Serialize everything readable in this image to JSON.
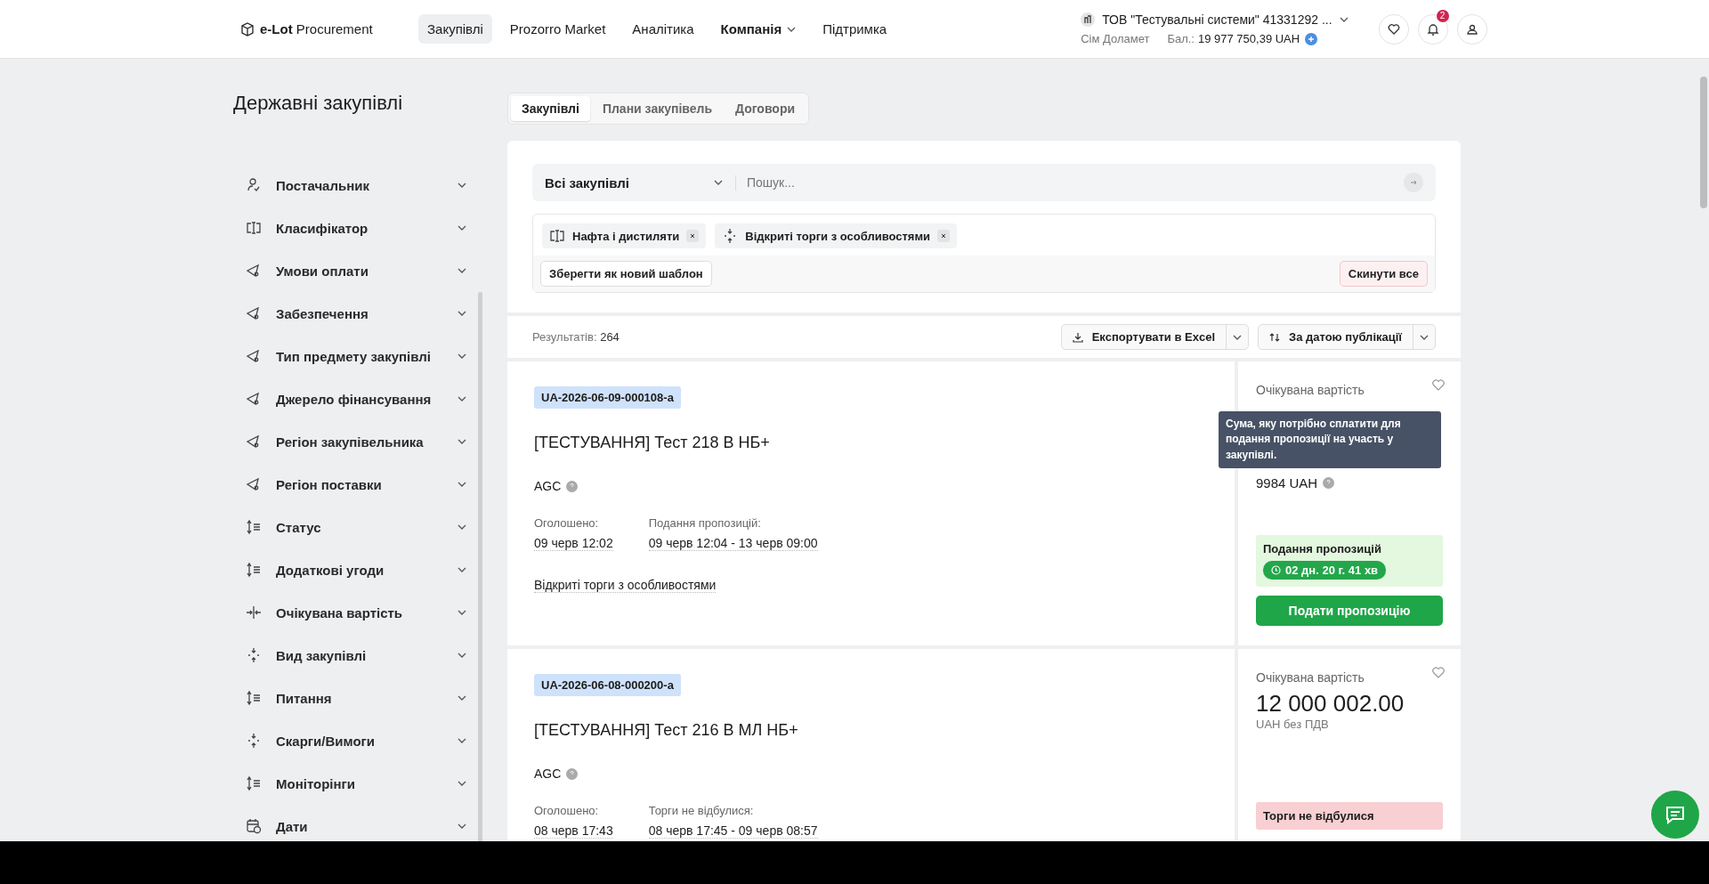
{
  "header": {
    "logo": "**e-Lot** Procurement",
    "nav": [
      {
        "label": "Закупівлі",
        "kind": "link",
        "selected": true
      },
      {
        "label": "Prozorro Market",
        "kind": "link",
        "selected": false
      },
      {
        "label": "Аналітика",
        "kind": "link",
        "selected": false
      },
      {
        "label": "Компанія",
        "kind": "dropdown",
        "selected": false
      },
      {
        "label": "Підтримка",
        "kind": "link",
        "selected": false
      }
    ],
    "company": "ТОВ \"Тестувальні системи\" 41331292 ...",
    "user": "Сім Доламет",
    "balance_label": "Бал.:",
    "balance": "19 977 750,39 UAH",
    "notifications": "2"
  },
  "page_title": "Державні закупівлі",
  "sidebar": {
    "items": [
      {
        "label": "Постачальник",
        "kind": "user"
      },
      {
        "label": "Класифікатор",
        "kind": "classifier"
      },
      {
        "label": "Умови оплати",
        "kind": "tag"
      },
      {
        "label": "Забезпечення",
        "kind": "tag"
      },
      {
        "label": "Тип предмету закупівлі",
        "kind": "tag"
      },
      {
        "label": "Джерело фінансування",
        "kind": "tag"
      },
      {
        "label": "Регіон закупівельника",
        "kind": "tag"
      },
      {
        "label": "Регіон поставки",
        "kind": "tag"
      },
      {
        "label": "Статус",
        "kind": "sort"
      },
      {
        "label": "Додаткові угоди",
        "kind": "sort"
      },
      {
        "label": "Очікувана вартість",
        "kind": "range"
      },
      {
        "label": "Вид закупівлі",
        "kind": "compress"
      },
      {
        "label": "Питання",
        "kind": "sort"
      },
      {
        "label": "Скарги/Вимоги",
        "kind": "compress"
      },
      {
        "label": "Моніторінги",
        "kind": "sort"
      },
      {
        "label": "Дати",
        "kind": "calendar"
      }
    ]
  },
  "tabs": [
    {
      "label": "Закупівлі",
      "selected": true
    },
    {
      "label": "Плани закупівель",
      "selected": false
    },
    {
      "label": "Договори",
      "selected": false
    }
  ],
  "search": {
    "scope": "Всі закупівлі",
    "placeholder": "Пошук..."
  },
  "filters": {
    "chips": [
      {
        "label": "Нафта і дистиляти",
        "kind": "classifier"
      },
      {
        "label": "Відкриті торги з особливостями",
        "kind": "compress"
      }
    ],
    "save_button": "Зберегти як новий шаблон",
    "reset_button": "Скинути все"
  },
  "results": {
    "label": "Результатів:",
    "count": "264",
    "export_button": "Експортувати в Excel",
    "sort_button": "За датою публікації"
  },
  "tenders": [
    {
      "id": "UA-2026-06-09-000108-a",
      "title": "[ТЕСТУВАННЯ] Тест 218 В НБ+",
      "organizer": "AGC",
      "announced_label": "Оголошено:",
      "announced": "09 черв 12:02",
      "period_label": "Подання пропозицій:",
      "period": "09 черв 12:04 - 13 черв 09:00",
      "procedure": "Відкриті торги з особливостями",
      "value_label": "Очікувана вартість",
      "fee": "9984 UAH",
      "tooltip": "Сума, яку потрібно сплатити для подання пропозиції на участь у закупівлі.",
      "status": {
        "kind": "active",
        "label": "Подання пропозицій",
        "timer": "02 дн. 20 г. 41 хв"
      },
      "action_button": "Подати пропозицію"
    },
    {
      "id": "UA-2026-06-08-000200-a",
      "title": "[ТЕСТУВАННЯ] Тест 216 В МЛ НБ+",
      "organizer": "AGC",
      "announced_label": "Оголошено:",
      "announced": "08 черв 17:43",
      "period_label": "Торги не відбулися:",
      "period": "08 черв 17:45 - 09 черв 08:57",
      "value_label": "Очікувана вартість",
      "value": "12 000 002.00",
      "value_note": "UAH без ПДВ",
      "status": {
        "kind": "failed",
        "label": "Торги не відбулися"
      }
    }
  ]
}
